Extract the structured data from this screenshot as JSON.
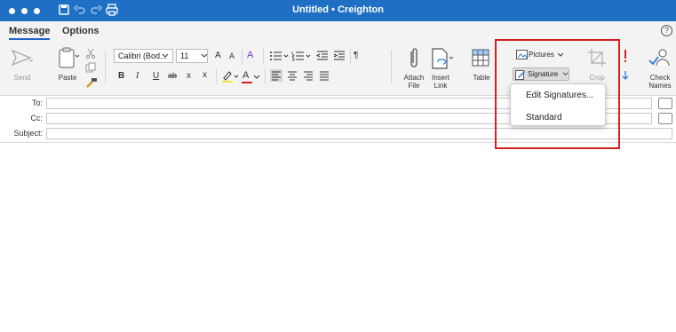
{
  "window": {
    "title": "Untitled • Creighton"
  },
  "tabs": [
    {
      "label": "Message",
      "active": true
    },
    {
      "label": "Options",
      "active": false
    }
  ],
  "help_icon": "?",
  "ribbon": {
    "send_label": "Send",
    "paste_label": "Paste",
    "font_name": "Calibri (Bod...",
    "font_size": "11",
    "attach_label": "Attach",
    "attach_label2": "File",
    "insert_label": "Insert",
    "insert_label2": "Link",
    "table_label": "Table",
    "pictures_label": "Pictures",
    "signature_label": "Signature",
    "crop_label": "Crop",
    "check_label": "Check",
    "check_label2": "Names",
    "grow_font": "A",
    "shrink_font": "A",
    "pilcrow": "¶",
    "bold": "B",
    "italic": "I",
    "underline": "U",
    "strike": "ab",
    "subscript": "x",
    "superscript": "x",
    "font_color": "A",
    "clear_format": "A"
  },
  "fields": {
    "to_label": "To:",
    "cc_label": "Cc:",
    "subject_label": "Subject:"
  },
  "signature_menu": {
    "items": [
      "Edit Signatures...",
      "Standard"
    ]
  },
  "colors": {
    "titlebar": "#1f6fc5",
    "highlight": "#d32020",
    "accent": "#2563c9"
  }
}
